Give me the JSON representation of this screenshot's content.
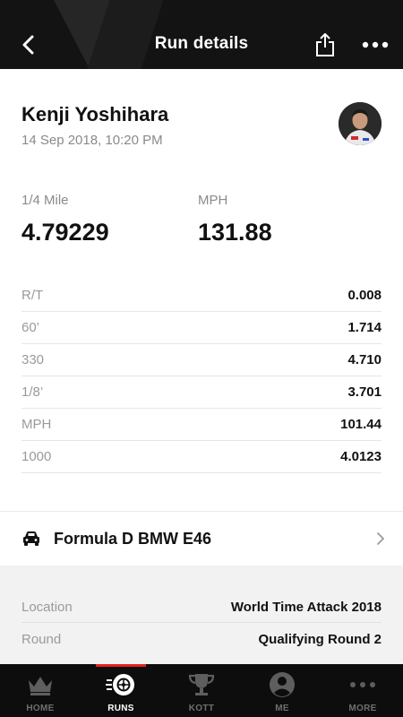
{
  "header": {
    "title": "Run details",
    "back_icon": "chevron-left-icon",
    "share_icon": "share-icon",
    "more_icon": "more-dots-icon"
  },
  "driver": {
    "name": "Kenji Yoshihara",
    "date": "14 Sep 2018, 10:20 PM"
  },
  "stats": {
    "quarter_mile_label": "1/4 Mile",
    "quarter_mile_value": "4.79229",
    "mph_label": "MPH",
    "mph_value": "131.88"
  },
  "timings": [
    {
      "label": "R/T",
      "value": "0.008"
    },
    {
      "label": "60’",
      "value": "1.714"
    },
    {
      "label": "330",
      "value": "4.710"
    },
    {
      "label": "1/8’",
      "value": "3.701"
    },
    {
      "label": "MPH",
      "value": "101.44"
    },
    {
      "label": "1000",
      "value": "4.0123"
    }
  ],
  "car": {
    "name": "Formula D BMW E46",
    "icon": "car-icon"
  },
  "event": {
    "location_label": "Location",
    "location_value": "World Time Attack 2018",
    "round_label": "Round",
    "round_value": "Qualifying Round 2"
  },
  "tabs": [
    {
      "label": "HOME",
      "icon": "crown-icon",
      "active": false
    },
    {
      "label": "RUNS",
      "icon": "tire-icon",
      "active": true
    },
    {
      "label": "KOTT",
      "icon": "trophy-icon",
      "active": false
    },
    {
      "label": "ME",
      "icon": "user-icon",
      "active": false
    },
    {
      "label": "MORE",
      "icon": "more-dots-icon",
      "active": false
    }
  ],
  "colors": {
    "header_bg": "#131313",
    "tabbar_bg": "#0d0d0d",
    "accent_red": "#e2231a",
    "event_bg": "#f2f2f2"
  }
}
